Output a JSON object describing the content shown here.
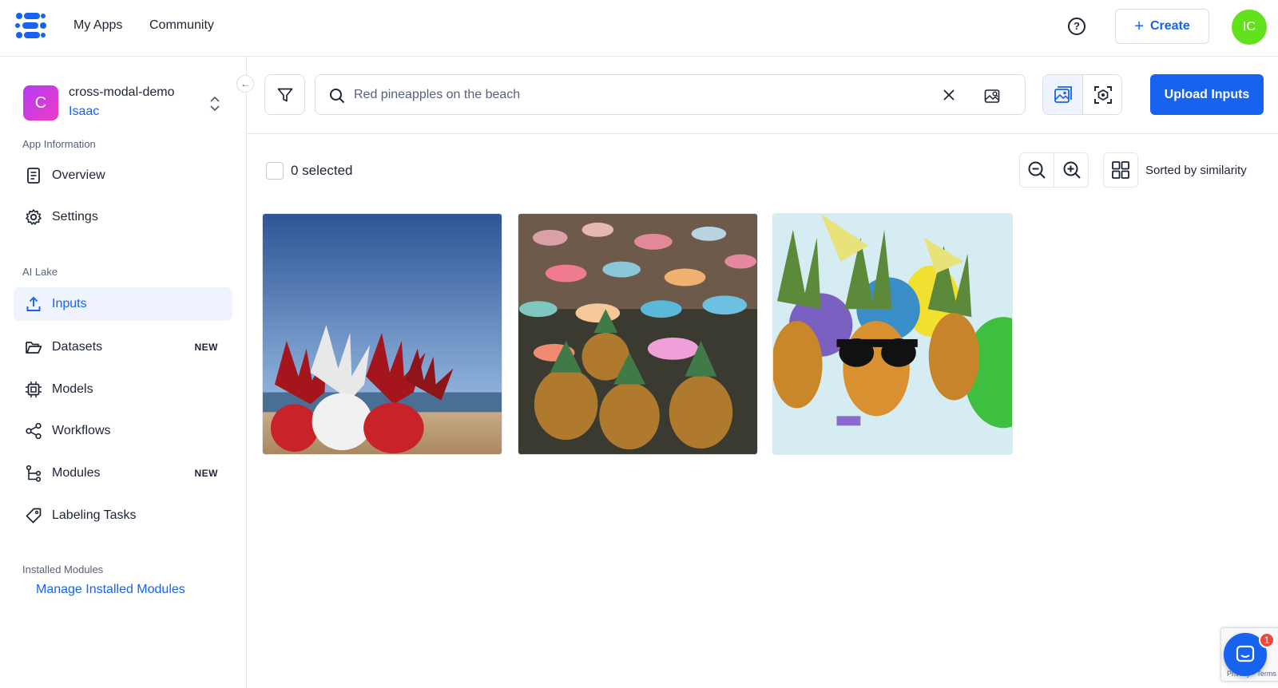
{
  "topbar": {
    "nav": [
      "My Apps",
      "Community"
    ],
    "help_icon": "question-circle-icon",
    "create_label": "Create",
    "user_initials": "IC",
    "user_avatar_color": "#62e21d"
  },
  "app": {
    "initial": "C",
    "name": "cross-modal-demo",
    "user": "Isaac"
  },
  "sidebar": {
    "sections": [
      "App Information",
      "AI Lake",
      "Installed Modules"
    ],
    "app_info_items": [
      {
        "label": "Overview",
        "icon": "document-icon"
      },
      {
        "label": "Settings",
        "icon": "gear-icon"
      }
    ],
    "ai_lake_items": [
      {
        "label": "Inputs",
        "icon": "upload-icon",
        "active": true
      },
      {
        "label": "Datasets",
        "icon": "folder-icon",
        "badge": "NEW"
      },
      {
        "label": "Models",
        "icon": "chip-icon"
      },
      {
        "label": "Workflows",
        "icon": "share-icon"
      },
      {
        "label": "Modules",
        "icon": "module-tree-icon",
        "badge": "NEW"
      },
      {
        "label": "Labeling Tasks",
        "icon": "tag-icon"
      }
    ],
    "manage_link": "Manage Installed Modules"
  },
  "search": {
    "value": "Red pineapples on the beach",
    "filter_icon": "filter-icon",
    "upload_label": "Upload Inputs"
  },
  "results": {
    "selected_text": "0 selected",
    "sort_text": "Sorted by similarity",
    "images": [
      {
        "alt": "red pineapples on the beach"
      },
      {
        "alt": "pineapples with cocktail umbrellas"
      },
      {
        "alt": "party pineapples with sunglasses"
      }
    ]
  },
  "widget": {
    "badge_count": "1",
    "recaptcha_text": "Privacy - Terms"
  },
  "colors": {
    "accent": "#1763ef",
    "active_bg": "#eef3fd",
    "border": "#e3e6eb"
  }
}
